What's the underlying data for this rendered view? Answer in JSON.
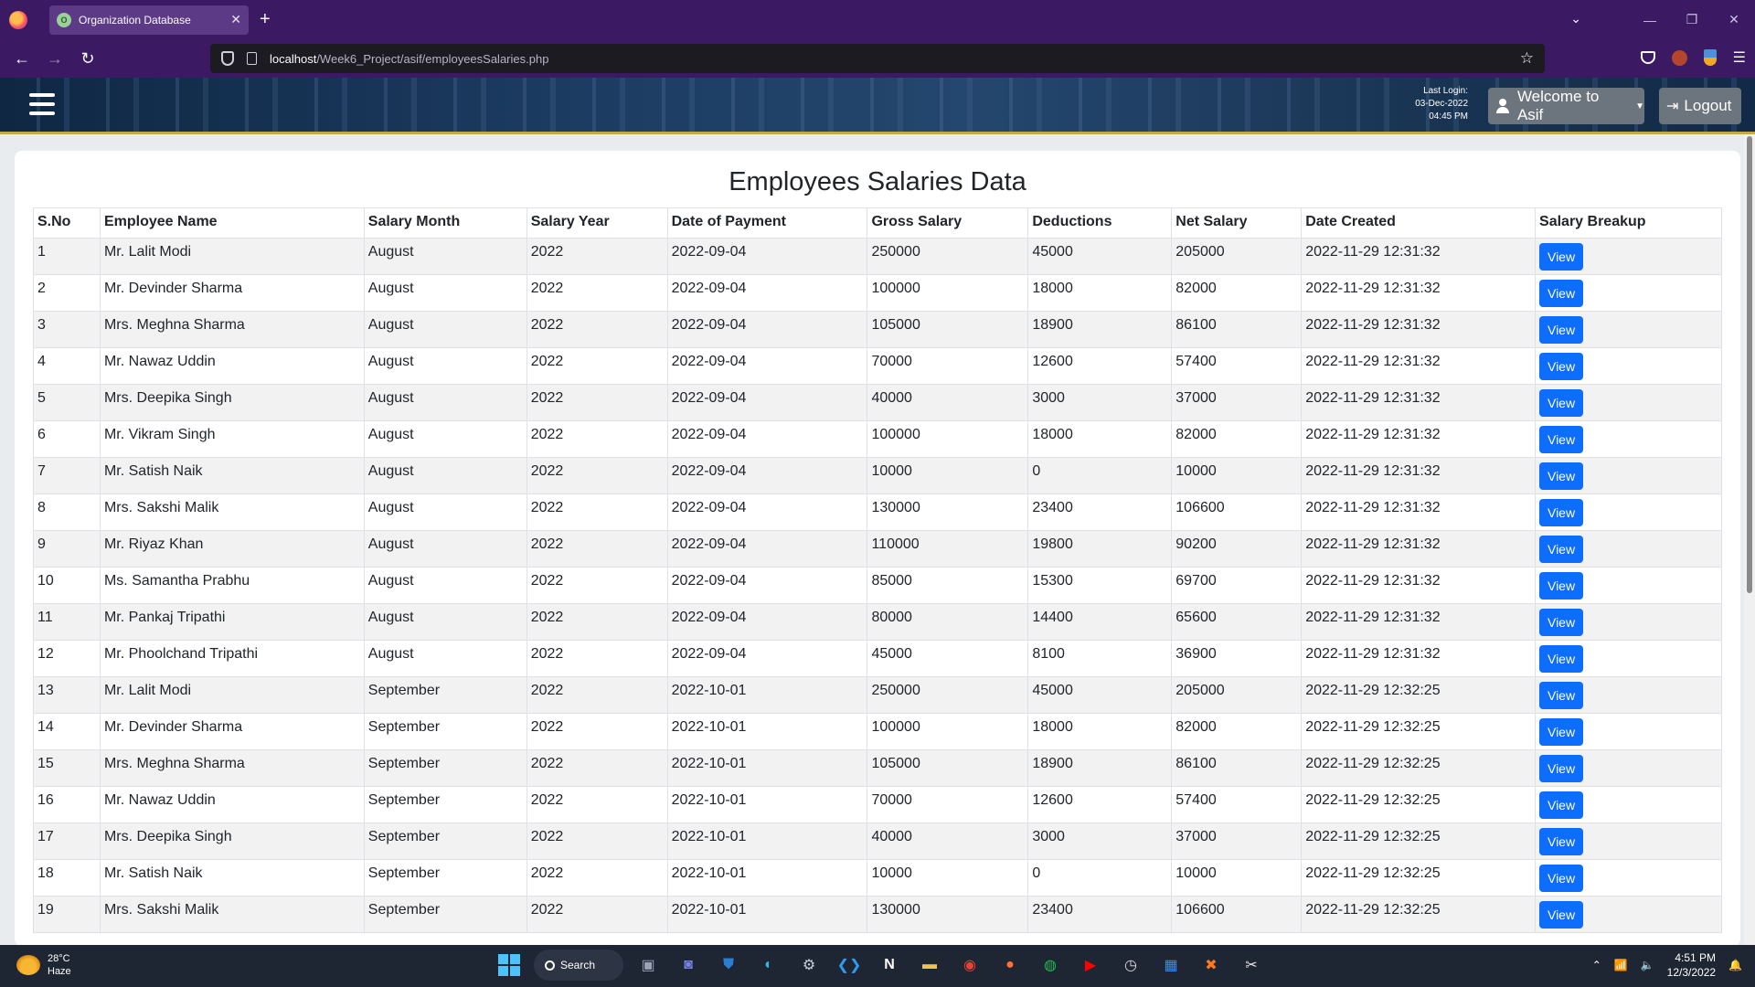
{
  "browser": {
    "tab_title": "Organization Database",
    "tab_favicon_text": "O",
    "url_host": "localhost",
    "url_path": "/Week6_Project/asif/employeesSalaries.php"
  },
  "header": {
    "last_login_label": "Last Login:",
    "last_login_date": "03-Dec-2022",
    "last_login_time": "04:45 PM",
    "welcome_label": "Welcome to Asif",
    "logout_label": "Logout"
  },
  "page": {
    "title": "Employees Salaries Data",
    "view_label": "View"
  },
  "table": {
    "headers": [
      "S.No",
      "Employee Name",
      "Salary Month",
      "Salary Year",
      "Date of Payment",
      "Gross Salary",
      "Deductions",
      "Net Salary",
      "Date Created",
      "Salary Breakup"
    ],
    "rows": [
      [
        "1",
        "Mr. Lalit Modi",
        "August",
        "2022",
        "2022-09-04",
        "250000",
        "45000",
        "205000",
        "2022-11-29 12:31:32"
      ],
      [
        "2",
        "Mr. Devinder Sharma",
        "August",
        "2022",
        "2022-09-04",
        "100000",
        "18000",
        "82000",
        "2022-11-29 12:31:32"
      ],
      [
        "3",
        "Mrs. Meghna Sharma",
        "August",
        "2022",
        "2022-09-04",
        "105000",
        "18900",
        "86100",
        "2022-11-29 12:31:32"
      ],
      [
        "4",
        "Mr. Nawaz Uddin",
        "August",
        "2022",
        "2022-09-04",
        "70000",
        "12600",
        "57400",
        "2022-11-29 12:31:32"
      ],
      [
        "5",
        "Mrs. Deepika Singh",
        "August",
        "2022",
        "2022-09-04",
        "40000",
        "3000",
        "37000",
        "2022-11-29 12:31:32"
      ],
      [
        "6",
        "Mr. Vikram Singh",
        "August",
        "2022",
        "2022-09-04",
        "100000",
        "18000",
        "82000",
        "2022-11-29 12:31:32"
      ],
      [
        "7",
        "Mr. Satish Naik",
        "August",
        "2022",
        "2022-09-04",
        "10000",
        "0",
        "10000",
        "2022-11-29 12:31:32"
      ],
      [
        "8",
        "Mrs. Sakshi Malik",
        "August",
        "2022",
        "2022-09-04",
        "130000",
        "23400",
        "106600",
        "2022-11-29 12:31:32"
      ],
      [
        "9",
        "Mr. Riyaz Khan",
        "August",
        "2022",
        "2022-09-04",
        "110000",
        "19800",
        "90200",
        "2022-11-29 12:31:32"
      ],
      [
        "10",
        "Ms. Samantha Prabhu",
        "August",
        "2022",
        "2022-09-04",
        "85000",
        "15300",
        "69700",
        "2022-11-29 12:31:32"
      ],
      [
        "11",
        "Mr. Pankaj Tripathi",
        "August",
        "2022",
        "2022-09-04",
        "80000",
        "14400",
        "65600",
        "2022-11-29 12:31:32"
      ],
      [
        "12",
        "Mr. Phoolchand Tripathi",
        "August",
        "2022",
        "2022-09-04",
        "45000",
        "8100",
        "36900",
        "2022-11-29 12:31:32"
      ],
      [
        "13",
        "Mr. Lalit Modi",
        "September",
        "2022",
        "2022-10-01",
        "250000",
        "45000",
        "205000",
        "2022-11-29 12:32:25"
      ],
      [
        "14",
        "Mr. Devinder Sharma",
        "September",
        "2022",
        "2022-10-01",
        "100000",
        "18000",
        "82000",
        "2022-11-29 12:32:25"
      ],
      [
        "15",
        "Mrs. Meghna Sharma",
        "September",
        "2022",
        "2022-10-01",
        "105000",
        "18900",
        "86100",
        "2022-11-29 12:32:25"
      ],
      [
        "16",
        "Mr. Nawaz Uddin",
        "September",
        "2022",
        "2022-10-01",
        "70000",
        "12600",
        "57400",
        "2022-11-29 12:32:25"
      ],
      [
        "17",
        "Mrs. Deepika Singh",
        "September",
        "2022",
        "2022-10-01",
        "40000",
        "3000",
        "37000",
        "2022-11-29 12:32:25"
      ],
      [
        "18",
        "Mr. Satish Naik",
        "September",
        "2022",
        "2022-10-01",
        "10000",
        "0",
        "10000",
        "2022-11-29 12:32:25"
      ],
      [
        "19",
        "Mrs. Sakshi Malik",
        "September",
        "2022",
        "2022-10-01",
        "130000",
        "23400",
        "106600",
        "2022-11-29 12:32:25"
      ]
    ]
  },
  "taskbar": {
    "temperature": "28°C",
    "weather": "Haze",
    "search_label": "Search",
    "time": "4:51 PM",
    "date": "12/3/2022"
  },
  "colors": {
    "browser_chrome": "#3b1a63",
    "primary_button": "#0d6efd",
    "secondary_button": "#6c757d",
    "header_border": "#c9a64a"
  }
}
